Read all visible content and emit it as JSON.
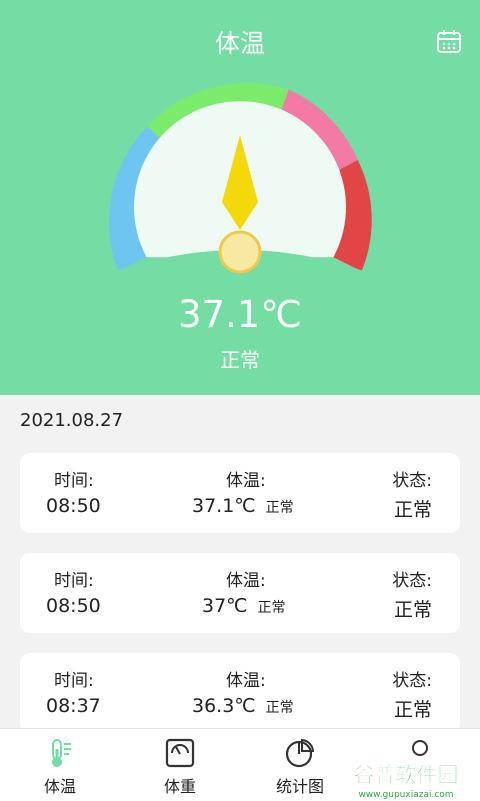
{
  "header": {
    "title": "体温"
  },
  "gauge": {
    "reading": 37.1,
    "display": "37.1℃",
    "status": "正常"
  },
  "date": "2021.08.27",
  "records": [
    {
      "time_label": "时间:",
      "time": "08:50",
      "temp_label": "体温:",
      "temp": "37.1℃",
      "temp_status": "正常",
      "state_label": "状态:",
      "state": "正常"
    },
    {
      "time_label": "时间:",
      "time": "08:50",
      "temp_label": "体温:",
      "temp": "37℃",
      "temp_status": "正常",
      "state_label": "状态:",
      "state": "正常"
    },
    {
      "time_label": "时间:",
      "time": "08:37",
      "temp_label": "体温:",
      "temp": "36.3℃",
      "temp_status": "正常",
      "state_label": "状态:",
      "state": "正常"
    }
  ],
  "nav": [
    {
      "label": "体温",
      "icon": "thermometer-icon",
      "active": true
    },
    {
      "label": "体重",
      "icon": "scale-icon",
      "active": false
    },
    {
      "label": "统计图",
      "icon": "pie-chart-icon",
      "active": false
    },
    {
      "label": "",
      "icon": "user-icon",
      "active": false
    }
  ],
  "watermark": {
    "title": "谷普软件园",
    "url": "www.gupuxiazai.com"
  },
  "colors": {
    "primary": "#73dda4",
    "blue": "#6ec6f0",
    "green": "#7aeb6b",
    "pink": "#f47aa6",
    "red": "#e14545",
    "needle": "#f4d90a"
  }
}
